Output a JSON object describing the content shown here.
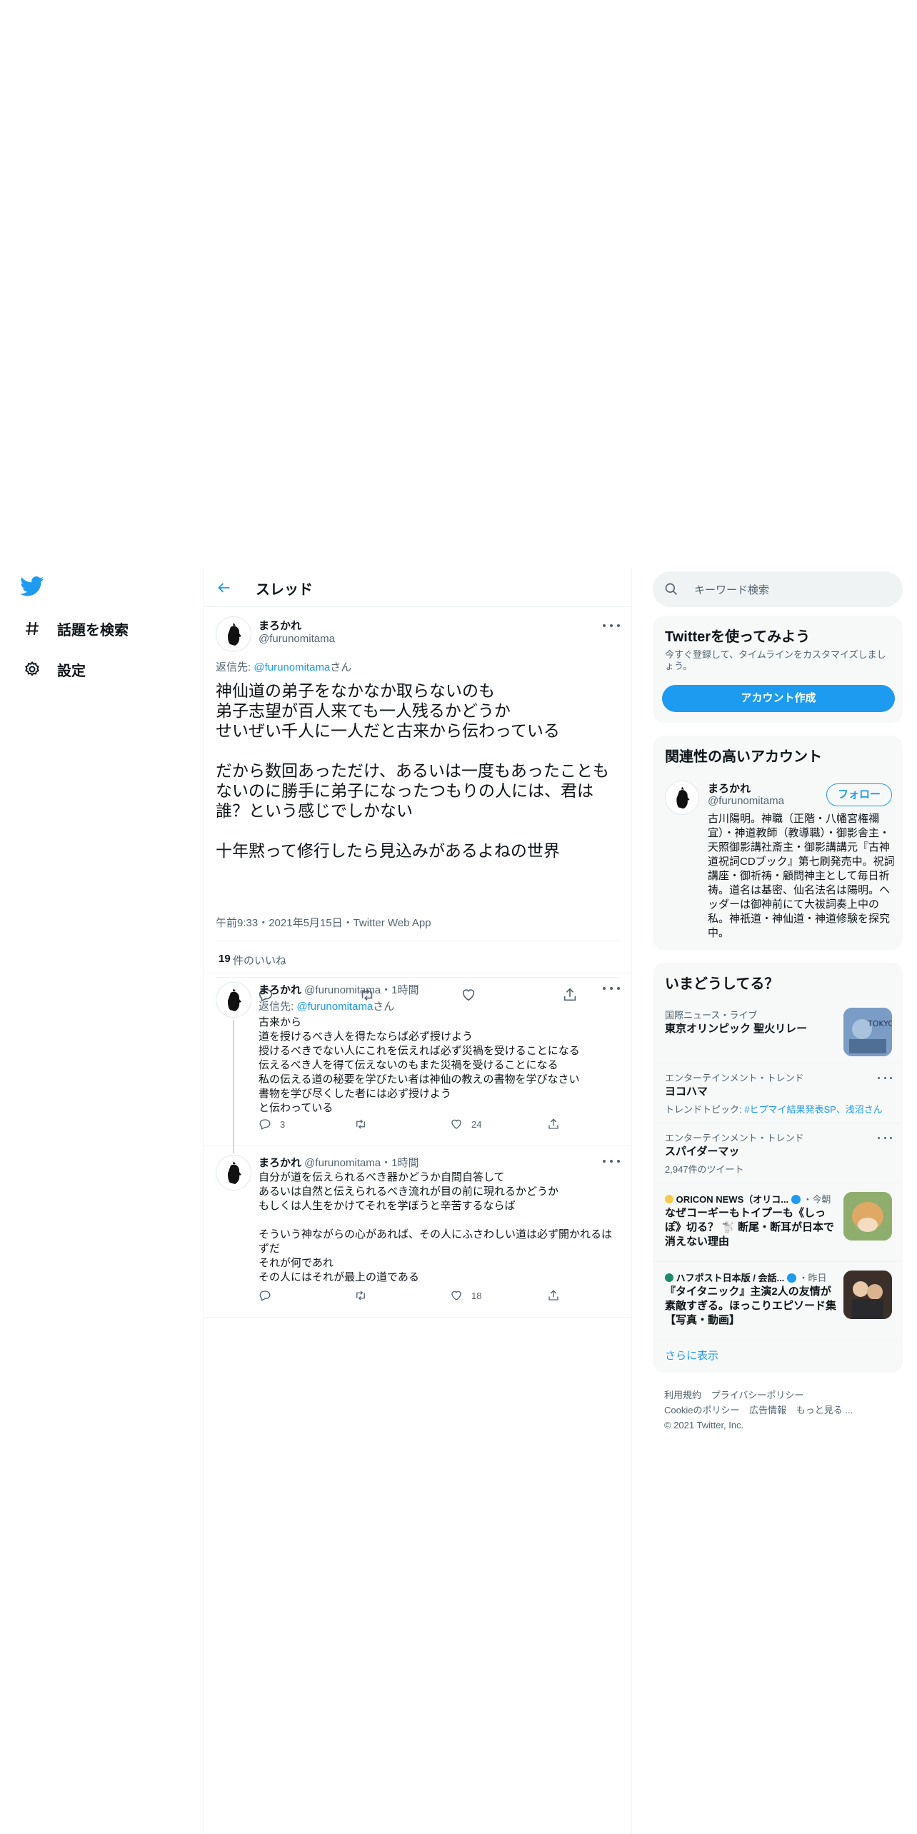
{
  "nav": {
    "logo": "twitter-bird-icon",
    "items": [
      {
        "label": "話題を検索",
        "icon": "hashtag-icon"
      },
      {
        "label": "設定",
        "icon": "gear-icon"
      }
    ]
  },
  "header": {
    "title": "スレッド",
    "back_icon": "arrow-left-icon"
  },
  "main_tweet": {
    "name": "まろかれ",
    "handle": "@furunomitama",
    "reply_prefix": "返信先: ",
    "reply_handle": "@furunomitama",
    "reply_suffix": "さん",
    "text": "神仙道の弟子をなかなか取らないのも\n弟子志望が百人来ても一人残るかどうか\nせいぜい千人に一人だと古来から伝わっている\n\nだから数回あっただけ、あるいは一度もあったこともないのに勝手に弟子になったつもりの人には、君は誰？という感じでしかない\n\n十年黙って修行したら見込みがあるよねの世界",
    "timestamp": "午前9:33・2021年5月15日・Twitter Web App",
    "likes_count": "19",
    "likes_label": "件のいいね"
  },
  "replies": [
    {
      "name": "まろかれ",
      "handle_time": " @furunomitama・1時間",
      "reply_prefix": "返信先: ",
      "reply_handle": "@furunomitama",
      "reply_suffix": "さん",
      "text": "古来から\n道を授けるべき人を得たならば必ず授けよう\n授けるべきでない人にこれを伝えれば必ず災禍を受けることになる\n伝えるべき人を得て伝えないのもまた災禍を受けることになる\n私の伝える道の秘要を学びたい者は神仙の教えの書物を学びなさい\n書物を学び尽くした者には必ず授けよう\nと伝わっている",
      "reply_count": "3",
      "retweet_count": "",
      "like_count": "24"
    },
    {
      "name": "まろかれ",
      "handle_time": " @furunomitama・1時間",
      "text": "自分が道を伝えられるべき器かどうか自問自答して\nあるいは自然と伝えられるべき流れが目の前に現れるかどうか\nもしくは人生をかけてそれを学ぼうと辛苦するならば\n\nそういう神ながらの心があれば、その人にふさわしい道は必ず開かれるはずだ\nそれが何であれ\nその人にはそれが最上の道である",
      "reply_count": "",
      "retweet_count": "",
      "like_count": "18"
    }
  ],
  "search": {
    "placeholder": "キーワード検索"
  },
  "signup": {
    "title": "Twitterを使ってみよう",
    "subtitle": "今すぐ登録して、タイムラインをカスタマイズしましょう。",
    "button": "アカウント作成"
  },
  "related": {
    "title": "関連性の高いアカウント",
    "name": "まろかれ",
    "handle": "@furunomitama",
    "follow": "フォロー",
    "bio": "古川陽明。神職（正階・八幡宮権禰宜）・神道教師（教導職）・御影舎主・天照御影講社斎主・御影講講元『古神道祝詞CDブック』第七刷発売中。祝詞講座・御祈祷・顧問神主として毎日祈祷。道名は基密、仙名法名は陽明。ヘッダーは御神前にて大祓詞奏上中の私。神祇道・神仙道・神道修験を探究中。"
  },
  "trends": {
    "title": "いまどうしてる？",
    "items": [
      {
        "meta": "国際ニュース・ライブ",
        "title": "東京オリンピック 聖火リレー",
        "thumb_text": "TOKYO"
      },
      {
        "meta": "エンターテインメント・トレンド",
        "title": "ヨコハマ",
        "sub_prefix": "トレンドトピック: ",
        "sub_link": "#ヒプマイ結果発表SP、浅沼さん"
      },
      {
        "meta": "エンターテインメント・トレンド",
        "title": "スパイダーマッ",
        "sub": "2,947件のツイート"
      },
      {
        "meta_source": "ORICON NEWS（オリコ...",
        "meta_time": "・今朝",
        "title": "なぜコーギーもトイプーも《しっぽ》切る？ 🐩 断尾・断耳が日本で消えない理由"
      },
      {
        "meta_source": "ハフポスト日本版 / 会話...",
        "meta_time": "・昨日",
        "title": "『タイタニック』主演2人の友情が素敵すぎる。ほっこりエピソード集【写真・動画】"
      }
    ],
    "show_more": "さらに表示"
  },
  "footer": {
    "links": [
      "利用規約",
      "プライバシーポリシー",
      "Cookieのポリシー",
      "広告情報",
      "もっと見る ..."
    ],
    "copyright": "© 2021 Twitter, Inc."
  },
  "colors": {
    "accent": "#1d9bf0",
    "text": "#0f1419",
    "muted": "#536471",
    "border": "#eff3f4"
  }
}
